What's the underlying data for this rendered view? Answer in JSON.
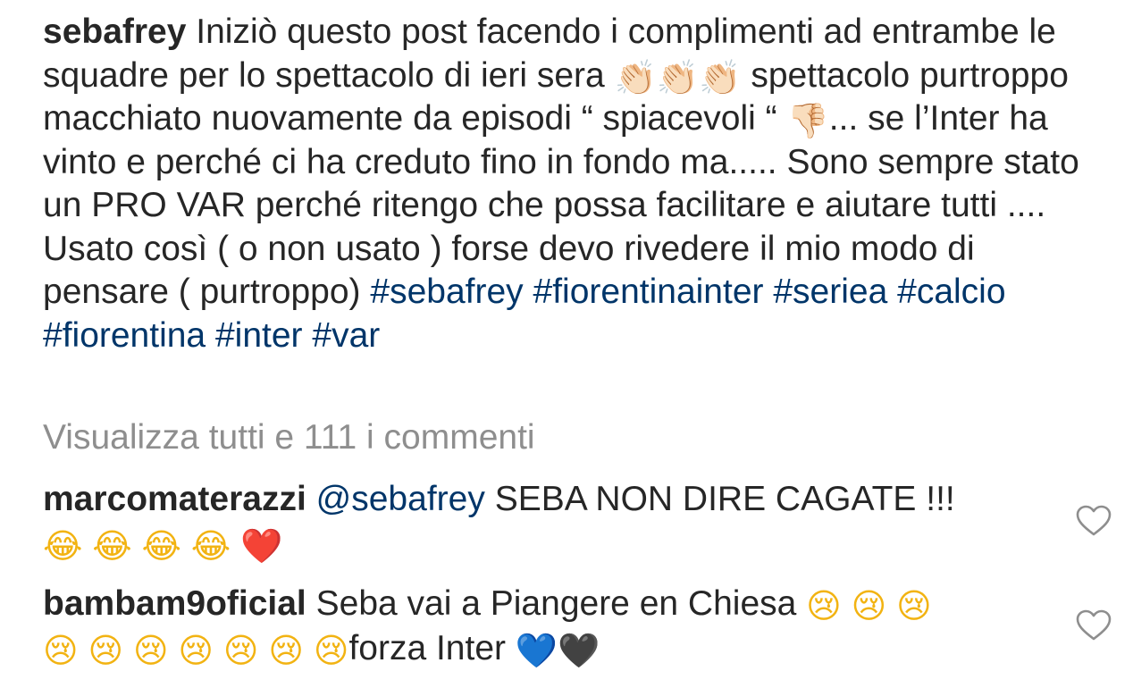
{
  "post": {
    "username": "sebafrey",
    "caption_parts": [
      "Iniziò questo post facendo i complimenti ad entrambe le squadre per lo spettacolo di ieri sera",
      "spettacolo purtroppo macchiato nuovamente da episodi “ spiacevoli “",
      "... se l’Inter ha vinto e perché ci ha creduto fino in fondo ma..... Sono sempre stato un PRO VAR perché ritengo che possa facilitare e aiutare tutti .... Usato così ( o non usato ) forse devo rivedere il mio modo di pensare ( purtroppo)"
    ],
    "hashtags": [
      "#sebafrey",
      "#fiorentinainter",
      "#seriea",
      "#calcio",
      "#fiorentina",
      "#inter",
      "#var"
    ],
    "emojis": {
      "clap": "👏🏻",
      "thumbs_down": "👎🏻"
    }
  },
  "view_all_comments": "Visualizza tutti e 111 i commenti",
  "comments": [
    {
      "username": "marcomaterazzi",
      "mention": "@sebafrey",
      "text": "SEBA NON DIRE CAGATE !!!",
      "emoji_laugh": "😂",
      "emoji_heart": "❤️",
      "like_icon": "heart-outline-icon"
    },
    {
      "username": "bambam9oficial",
      "text": "Seba vai a Piangere en Chiesa",
      "emoji_cry": "😢",
      "text_after": "forza Inter",
      "emoji_blue_heart": "💙",
      "emoji_black_heart": "🖤",
      "like_icon": "heart-outline-icon"
    }
  ],
  "colors": {
    "text": "#262626",
    "hashtag": "#003569",
    "muted": "#8e8e8e"
  }
}
